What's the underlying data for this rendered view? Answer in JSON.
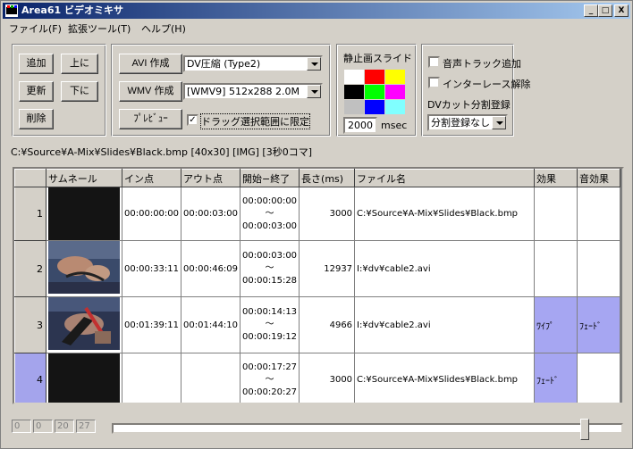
{
  "window": {
    "title": "Area61 ビデオミキサ",
    "minimize": "_",
    "maximize": "□",
    "close": "X"
  },
  "menu": {
    "items": [
      "ファイル(F)",
      "拡張ツール(T)",
      "ヘルプ(H)"
    ]
  },
  "clip_buttons": {
    "add": "追加",
    "up": "上に",
    "update": "更新",
    "down": "下に",
    "delete": "削除"
  },
  "encode": {
    "avi_button": "AVI 作成",
    "avi_codec": "DV圧縮 (Type2)",
    "wmv_button": "WMV 作成",
    "wmv_profile": "[WMV9] 512x288 2.0M",
    "preview_button": "ﾌﾟﾚﾋﾞｭｰ",
    "drag_range_label": "ドラッグ選択範囲に限定",
    "drag_range_checked": "✓"
  },
  "still_slide": {
    "label": "静止画スライド",
    "duration": "2000",
    "unit": "msec",
    "colors": [
      "#ffffff",
      "#ff0000",
      "#ffff00",
      "#000000",
      "#00ff00",
      "#ff00ff",
      "#c0c0c0",
      "#0000ff",
      "#80ffff"
    ]
  },
  "options": {
    "audio_track_label": "音声トラック追加",
    "deinterlace_label": "インターレース解除",
    "dv_split_label": "DVカット分割登録",
    "dv_split_value": "分割登録なし"
  },
  "status_line": "C:¥Source¥A-Mix¥Slides¥Black.bmp [40x30] [IMG] [3秒0コマ]",
  "table": {
    "columns": [
      "サムネール",
      "イン点",
      "アウト点",
      "開始−終了",
      "長さ(ms)",
      "ファイル名",
      "効果",
      "音効果"
    ],
    "rows": [
      {
        "index": "1",
        "in": "00:00:00:00",
        "out": "00:00:03:00",
        "start": "00:00:00:00",
        "tilde": "〜",
        "end": "00:00:03:00",
        "length": "3000",
        "file": "C:¥Source¥A-Mix¥Slides¥Black.bmp",
        "effect": "",
        "sound_effect": ""
      },
      {
        "index": "2",
        "in": "00:00:33:11",
        "out": "00:00:46:09",
        "start": "00:00:03:00",
        "tilde": "〜",
        "end": "00:00:15:28",
        "length": "12937",
        "file": "I:¥dv¥cable2.avi",
        "effect": "",
        "sound_effect": ""
      },
      {
        "index": "3",
        "in": "00:01:39:11",
        "out": "00:01:44:10",
        "start": "00:00:14:13",
        "tilde": "〜",
        "end": "00:00:19:12",
        "length": "4966",
        "file": "I:¥dv¥cable2.avi",
        "effect": "ﾜｲﾌﾟ",
        "sound_effect": "ﾌｪｰﾄﾞ"
      },
      {
        "index": "4",
        "in": "",
        "out": "",
        "start": "00:00:17:27",
        "tilde": "〜",
        "end": "00:00:20:27",
        "length": "3000",
        "file": "C:¥Source¥A-Mix¥Slides¥Black.bmp",
        "effect": "ﾌｪｰﾄﾞ",
        "sound_effect": ""
      }
    ]
  },
  "timecode": [
    "0",
    "0",
    "20",
    "27"
  ]
}
